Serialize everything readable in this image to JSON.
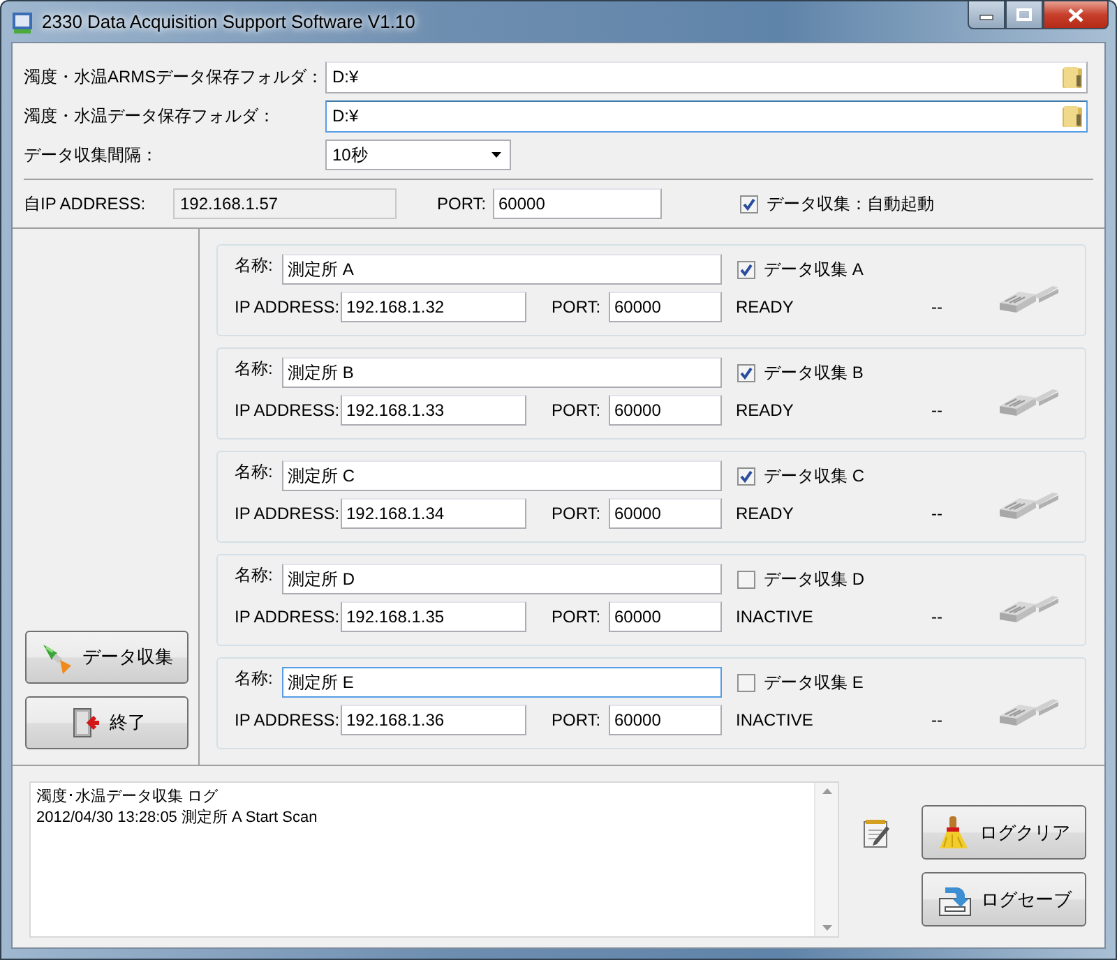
{
  "window": {
    "title": "2330 Data Acquisition Support Software V1.10"
  },
  "folders": [
    {
      "label": "濁度・水温ARMSデータ保存フォルダ：",
      "value": "D:¥",
      "focused": false
    },
    {
      "label": "濁度・水温データ保存フォルダ：",
      "value": "D:¥",
      "focused": true
    }
  ],
  "interval": {
    "label": "データ収集間隔：",
    "value": "10秒"
  },
  "local": {
    "ip_label": "自IP ADDRESS:",
    "ip": "192.168.1.57",
    "port_label": "PORT:",
    "port": "60000",
    "autostart_label": "データ収集：自動起動",
    "autostart_checked": true
  },
  "stations": [
    {
      "name_label": "名称:",
      "name": "測定所 A",
      "focused": false,
      "checked": true,
      "check_label": "データ収集 A",
      "ip_label": "IP ADDRESS:",
      "ip": "192.168.1.32",
      "port_label": "PORT:",
      "port": "60000",
      "status": "READY",
      "reading": "--"
    },
    {
      "name_label": "名称:",
      "name": "測定所 B",
      "focused": false,
      "checked": true,
      "check_label": "データ収集 B",
      "ip_label": "IP ADDRESS:",
      "ip": "192.168.1.33",
      "port_label": "PORT:",
      "port": "60000",
      "status": "READY",
      "reading": "--"
    },
    {
      "name_label": "名称:",
      "name": "測定所 C",
      "focused": false,
      "checked": true,
      "check_label": "データ収集 C",
      "ip_label": "IP ADDRESS:",
      "ip": "192.168.1.34",
      "port_label": "PORT:",
      "port": "60000",
      "status": "READY",
      "reading": "--"
    },
    {
      "name_label": "名称:",
      "name": "測定所 D",
      "focused": false,
      "checked": false,
      "check_label": "データ収集 D",
      "ip_label": "IP ADDRESS:",
      "ip": "192.168.1.35",
      "port_label": "PORT:",
      "port": "60000",
      "status": "INACTIVE",
      "reading": "--"
    },
    {
      "name_label": "名称:",
      "name": "測定所 E",
      "focused": true,
      "checked": false,
      "check_label": "データ収集 E",
      "ip_label": "IP ADDRESS:",
      "ip": "192.168.1.36",
      "port_label": "PORT:",
      "port": "60000",
      "status": "INACTIVE",
      "reading": "--"
    }
  ],
  "side_buttons": [
    {
      "kind": "collect",
      "label": "データ収集"
    },
    {
      "kind": "exit",
      "label": "終了"
    }
  ],
  "log": {
    "lines": [
      "濁度･水温データ収集 ログ",
      "2012/04/30 13:28:05 測定所 A Start Scan"
    ]
  },
  "log_buttons": [
    {
      "kind": "clear",
      "label": "ログクリア"
    },
    {
      "kind": "save",
      "label": "ログセーブ"
    }
  ]
}
